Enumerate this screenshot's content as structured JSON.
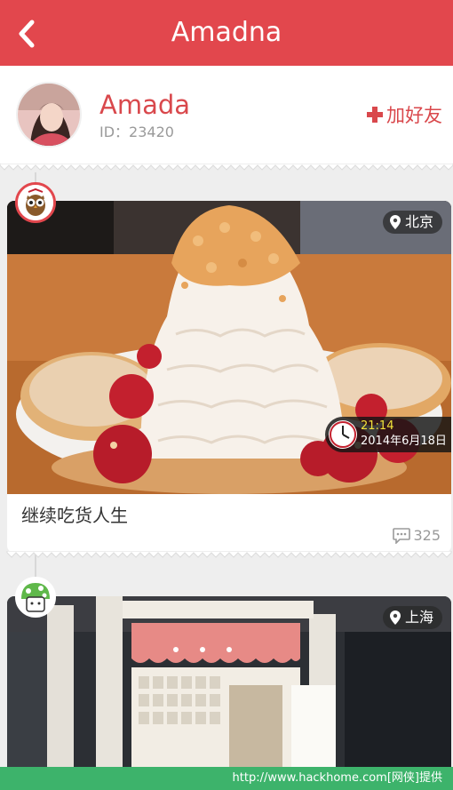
{
  "header": {
    "title": "Amadna",
    "back_icon": "chevron-left-icon"
  },
  "profile": {
    "name": "Amada",
    "id_text": "ID：23420",
    "add_friend_label": "加好友",
    "add_icon": "plus-icon"
  },
  "posts": [
    {
      "location": "北京",
      "time": "21:14",
      "date": "2014年6月18日",
      "caption": "继续吃货人生",
      "comments": "325",
      "badge_icon": "owl-icon"
    },
    {
      "location": "上海",
      "badge_icon": "mushroom-icon"
    }
  ],
  "watermark": "http://www.hackhome.com[网侠]提供",
  "colors": {
    "brand": "#e2474d",
    "name": "#d9484c",
    "watermark": "#3db36b"
  }
}
